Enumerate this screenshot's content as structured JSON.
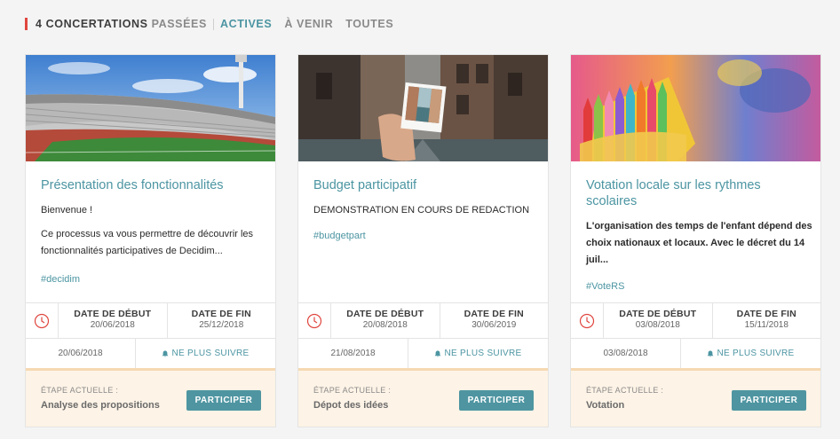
{
  "filters": {
    "count_label": "4 CONCERTATIONS",
    "items": [
      {
        "label": "PASSÉES"
      },
      {
        "label": "ACTIVES"
      },
      {
        "label": "À VENIR"
      },
      {
        "label": "TOUTES"
      }
    ],
    "active_color": "#4c95a2"
  },
  "labels": {
    "start": "DATE DE DÉBUT",
    "end": "DATE DE FIN",
    "follow": "NE PLUS SUIVRE",
    "step": "ÉTAPE ACTUELLE :",
    "participate": "PARTICIPER"
  },
  "cards": [
    {
      "title": "Présentation des fonctionnalités",
      "body": [
        "Bienvenue !",
        "Ce processus va vous permettre de découvrir les fonctionnalités participatives de Decidim..."
      ],
      "hashtag": "#decidim",
      "start_date": "20/06/2018",
      "end_date": "25/12/2018",
      "published": "20/06/2018",
      "step_name": "Analyse des propositions"
    },
    {
      "title": "Budget participatif",
      "body": [
        "DEMONSTRATION EN COURS DE REDACTION"
      ],
      "hashtag": "#budgetpart",
      "start_date": "20/08/2018",
      "end_date": "30/06/2019",
      "published": "21/08/2018",
      "step_name": "Dépot des idées"
    },
    {
      "title": "Votation locale sur les rythmes scolaires",
      "body": [
        "L'organisation des temps de l'enfant dépend des choix nationaux et locaux. Avec le décret du 14 juil..."
      ],
      "hashtag": "#VoteRS",
      "start_date": "03/08/2018",
      "end_date": "15/11/2018",
      "published": "03/08/2018",
      "step_name": "Votation"
    }
  ],
  "icons": {
    "clock": "clock-icon",
    "bell": "bell-icon"
  },
  "colors": {
    "accent": "#e0463f",
    "link": "#4c95a2",
    "button": "#4e95a1",
    "step_bg": "#fdf3e6"
  }
}
